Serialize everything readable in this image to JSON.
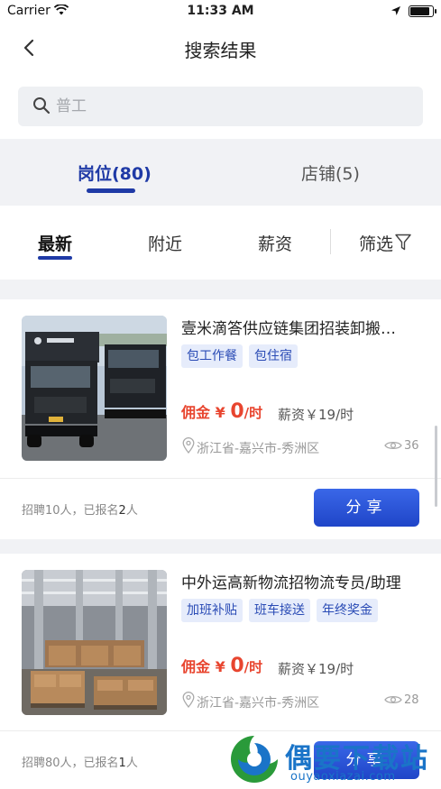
{
  "status_bar": {
    "carrier": "Carrier",
    "time": "11:33 AM"
  },
  "nav": {
    "title": "搜索结果"
  },
  "search": {
    "placeholder": "普工"
  },
  "tabs": [
    {
      "label": "岗位(80)"
    },
    {
      "label": "店铺(5)"
    }
  ],
  "filters": [
    {
      "label": "最新"
    },
    {
      "label": "附近"
    },
    {
      "label": "薪资"
    },
    {
      "label": "筛选"
    }
  ],
  "jobs": [
    {
      "title": "壹米滴答供应链集团招装卸搬…",
      "tags": [
        "包工作餐",
        "包住宿"
      ],
      "commission_label": "佣金",
      "commission_currency": "¥",
      "commission_amount": "0",
      "commission_unit": "/时",
      "salary": "薪资￥19/时",
      "location": "浙江省-嘉兴市-秀洲区",
      "views": "36",
      "recruit_prefix": "招聘10人，已报名",
      "recruit_count": "2",
      "recruit_suffix": "人",
      "share_label": "分享",
      "image": "trucks-photo"
    },
    {
      "title": "中外运高新物流招物流专员/助理",
      "tags": [
        "加班补贴",
        "班车接送",
        "年终奖金"
      ],
      "commission_label": "佣金",
      "commission_currency": "¥",
      "commission_amount": "0",
      "commission_unit": "/时",
      "salary": "薪资￥19/时",
      "location": "浙江省-嘉兴市-秀洲区",
      "views": "28",
      "recruit_prefix": "招聘80人，已报名",
      "recruit_count": "1",
      "recruit_suffix": "人",
      "share_label": "分享",
      "image": "warehouse-photo"
    }
  ],
  "watermark": {
    "text": "偶要下载站",
    "url": "ouyaoxiazai.com"
  },
  "colors": {
    "brand": "#1f3aa6",
    "commission": "#e8452f",
    "share_button": "#2a56d8",
    "tag_bg": "#e6ecfb"
  }
}
